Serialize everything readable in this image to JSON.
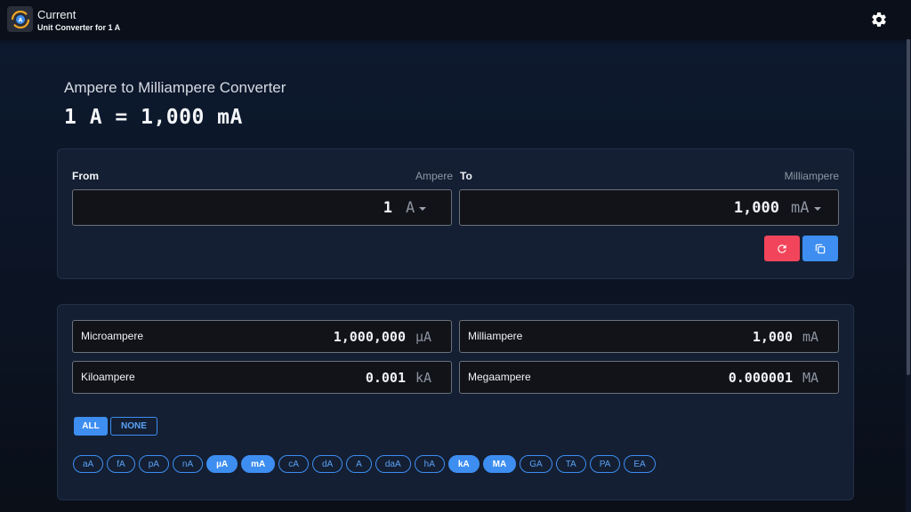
{
  "header": {
    "app_title": "Current",
    "app_subtitle": "Unit Converter for 1 A",
    "app_icon": "current-converter-icon",
    "settings_icon": "gear-icon"
  },
  "main": {
    "heading": "Ampere to Milliampere Converter",
    "result": "1 A = 1,000 mA"
  },
  "converter": {
    "from_label": "From",
    "from_unit_name": "Ampere",
    "from_value": "1",
    "from_unit": "A",
    "to_label": "To",
    "to_unit_name": "Milliampere",
    "to_value": "1,000",
    "to_unit": "mA",
    "reset_icon": "refresh-icon",
    "copy_icon": "copy-icon"
  },
  "conversions": [
    {
      "name": "Microampere",
      "value": "1,000,000",
      "symbol": "µA"
    },
    {
      "name": "Milliampere",
      "value": "1,000",
      "symbol": "mA"
    },
    {
      "name": "Kiloampere",
      "value": "0.001",
      "symbol": "kA"
    },
    {
      "name": "Megaampere",
      "value": "0.000001",
      "symbol": "MA"
    }
  ],
  "toggles": {
    "all_label": "ALL",
    "none_label": "NONE"
  },
  "units": [
    {
      "label": "aA",
      "selected": false
    },
    {
      "label": "fA",
      "selected": false
    },
    {
      "label": "pA",
      "selected": false
    },
    {
      "label": "nA",
      "selected": false
    },
    {
      "label": "µA",
      "selected": true
    },
    {
      "label": "mA",
      "selected": true
    },
    {
      "label": "cA",
      "selected": false
    },
    {
      "label": "dA",
      "selected": false
    },
    {
      "label": "A",
      "selected": false
    },
    {
      "label": "daA",
      "selected": false
    },
    {
      "label": "hA",
      "selected": false
    },
    {
      "label": "kA",
      "selected": true
    },
    {
      "label": "MA",
      "selected": true
    },
    {
      "label": "GA",
      "selected": false
    },
    {
      "label": "TA",
      "selected": false
    },
    {
      "label": "PA",
      "selected": false
    },
    {
      "label": "EA",
      "selected": false
    }
  ],
  "colors": {
    "accent": "#3d8ef0",
    "reset": "#f2455b",
    "background": "#0c1424"
  }
}
